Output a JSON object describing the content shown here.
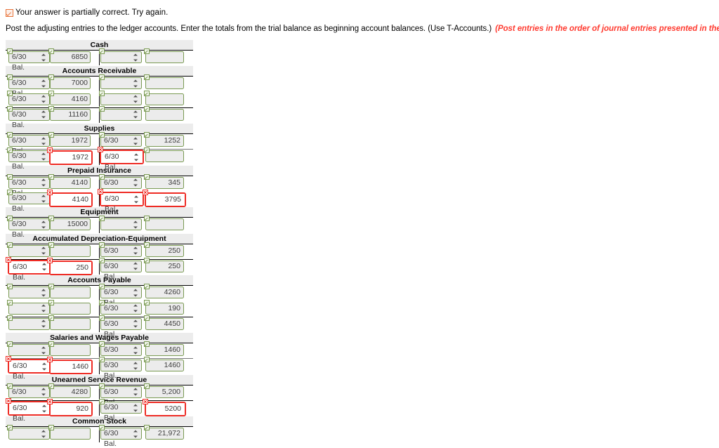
{
  "status": {
    "icon": "partial-check-icon",
    "text": "Your answer is partially correct.  Try again."
  },
  "instruction": {
    "text": "Post the adjusting entries to the ledger accounts. Enter the totals from the trial balance as beginning account balances. (Use T-Accounts.)",
    "hint": "(Post entries in the order of journal entries presented in the previous question.)"
  },
  "field_defaults": {
    "empty_select": "",
    "empty_amount": ""
  },
  "accounts": [
    {
      "name": "Cash",
      "rows": [
        {
          "rule": "black",
          "debit_date": {
            "value": "6/30 Bal.",
            "state": "correct"
          },
          "debit_amt": {
            "value": "6850",
            "state": "correct"
          },
          "credit_date": {
            "value": "",
            "state": "correct"
          },
          "credit_amt": {
            "value": "",
            "state": "correct"
          }
        }
      ]
    },
    {
      "name": "Accounts Receivable",
      "rows": [
        {
          "rule": "black",
          "debit_date": {
            "value": "6/30 Bal.",
            "state": "correct"
          },
          "debit_amt": {
            "value": "7000",
            "state": "correct"
          },
          "credit_date": {
            "value": "",
            "state": "correct"
          },
          "credit_amt": {
            "value": "",
            "state": "correct"
          }
        },
        {
          "rule": "none",
          "debit_date": {
            "value": "6/30",
            "state": "correct"
          },
          "debit_amt": {
            "value": "4160",
            "state": "correct"
          },
          "credit_date": {
            "value": "",
            "state": "correct"
          },
          "credit_amt": {
            "value": "",
            "state": "correct"
          }
        },
        {
          "rule": "black",
          "debit_date": {
            "value": "6/30 Bal.",
            "state": "correct"
          },
          "debit_amt": {
            "value": "11160",
            "state": "correct"
          },
          "credit_date": {
            "value": "",
            "state": "correct"
          },
          "credit_amt": {
            "value": "",
            "state": "correct"
          }
        }
      ]
    },
    {
      "name": "Supplies",
      "rows": [
        {
          "rule": "black",
          "debit_date": {
            "value": "6/30 Bal.",
            "state": "correct"
          },
          "debit_amt": {
            "value": "1972",
            "state": "correct"
          },
          "credit_date": {
            "value": "6/30",
            "state": "correct"
          },
          "credit_amt": {
            "value": "1252",
            "state": "correct"
          }
        },
        {
          "rule": "grey",
          "debit_date": {
            "value": "6/30 Bal.",
            "state": "correct"
          },
          "debit_amt": {
            "value": "1972",
            "state": "wrong"
          },
          "credit_date": {
            "value": "6/30 Bal.",
            "state": "wrong"
          },
          "credit_amt": {
            "value": "",
            "state": "correct"
          }
        }
      ]
    },
    {
      "name": "Prepaid Insurance",
      "rows": [
        {
          "rule": "black",
          "debit_date": {
            "value": "6/30 Bal.",
            "state": "correct"
          },
          "debit_amt": {
            "value": "4140",
            "state": "correct"
          },
          "credit_date": {
            "value": "6/30",
            "state": "correct"
          },
          "credit_amt": {
            "value": "345",
            "state": "correct"
          }
        },
        {
          "rule": "none",
          "debit_date": {
            "value": "6/30 Bal.",
            "state": "correct"
          },
          "debit_amt": {
            "value": "4140",
            "state": "wrong"
          },
          "credit_date": {
            "value": "6/30 Bal.",
            "state": "wrong"
          },
          "credit_amt": {
            "value": "3795",
            "state": "wrong"
          }
        }
      ]
    },
    {
      "name": "Equipment",
      "rows": [
        {
          "rule": "black",
          "debit_date": {
            "value": "6/30 Bal.",
            "state": "correct"
          },
          "debit_amt": {
            "value": "15000",
            "state": "correct"
          },
          "credit_date": {
            "value": "",
            "state": "correct"
          },
          "credit_amt": {
            "value": "",
            "state": "correct"
          }
        }
      ]
    },
    {
      "name": "Accumulated Depreciation-Equipment",
      "rows": [
        {
          "rule": "black",
          "debit_date": {
            "value": "",
            "state": "correct"
          },
          "debit_amt": {
            "value": "",
            "state": "correct"
          },
          "credit_date": {
            "value": "6/30",
            "state": "correct"
          },
          "credit_amt": {
            "value": "250",
            "state": "correct"
          }
        },
        {
          "rule": "black",
          "debit_date": {
            "value": "6/30 Bal.",
            "state": "wrong"
          },
          "debit_amt": {
            "value": "250",
            "state": "wrong"
          },
          "credit_date": {
            "value": "6/30 Bal.",
            "state": "correct"
          },
          "credit_amt": {
            "value": "250",
            "state": "correct"
          }
        }
      ]
    },
    {
      "name": "Accounts Payable",
      "rows": [
        {
          "rule": "black",
          "debit_date": {
            "value": "",
            "state": "correct"
          },
          "debit_amt": {
            "value": "",
            "state": "correct"
          },
          "credit_date": {
            "value": "6/30 Bal.",
            "state": "correct"
          },
          "credit_amt": {
            "value": "4260",
            "state": "correct"
          }
        },
        {
          "rule": "none",
          "debit_date": {
            "value": "",
            "state": "correct"
          },
          "debit_amt": {
            "value": "",
            "state": "correct"
          },
          "credit_date": {
            "value": "6/30",
            "state": "correct"
          },
          "credit_amt": {
            "value": "190",
            "state": "correct"
          }
        },
        {
          "rule": "black",
          "debit_date": {
            "value": "",
            "state": "correct"
          },
          "debit_amt": {
            "value": "",
            "state": "correct"
          },
          "credit_date": {
            "value": "6/30 Bal.",
            "state": "correct"
          },
          "credit_amt": {
            "value": "4450",
            "state": "correct"
          }
        }
      ]
    },
    {
      "name": "Salaries and Wages Payable",
      "rows": [
        {
          "rule": "black",
          "debit_date": {
            "value": "",
            "state": "correct"
          },
          "debit_amt": {
            "value": "",
            "state": "correct"
          },
          "credit_date": {
            "value": "6/30",
            "state": "correct"
          },
          "credit_amt": {
            "value": "1460",
            "state": "correct"
          }
        },
        {
          "rule": "grey",
          "debit_date": {
            "value": "6/30 Bal.",
            "state": "wrong"
          },
          "debit_amt": {
            "value": "1460",
            "state": "wrong"
          },
          "credit_date": {
            "value": "6/30 Bal.",
            "state": "correct"
          },
          "credit_amt": {
            "value": "1460",
            "state": "correct"
          }
        }
      ]
    },
    {
      "name": "Unearned Service Revenue",
      "rows": [
        {
          "rule": "black",
          "debit_date": {
            "value": "6/30",
            "state": "correct"
          },
          "debit_amt": {
            "value": "4280",
            "state": "correct"
          },
          "credit_date": {
            "value": "6/30 Bal.",
            "state": "correct"
          },
          "credit_amt": {
            "value": "5,200",
            "state": "correct"
          }
        },
        {
          "rule": "black",
          "debit_date": {
            "value": "6/30 Bal.",
            "state": "wrong"
          },
          "debit_amt": {
            "value": "920",
            "state": "wrong"
          },
          "credit_date": {
            "value": "6/30 Bal.",
            "state": "correct"
          },
          "credit_amt": {
            "value": "5200",
            "state": "wrong"
          }
        }
      ]
    },
    {
      "name": "Common Stock",
      "rows": [
        {
          "rule": "black",
          "debit_date": {
            "value": "",
            "state": "correct"
          },
          "debit_amt": {
            "value": "",
            "state": "correct"
          },
          "credit_date": {
            "value": "6/30 Bal.",
            "state": "correct"
          },
          "credit_amt": {
            "value": "21,972",
            "state": "correct"
          }
        }
      ]
    }
  ]
}
